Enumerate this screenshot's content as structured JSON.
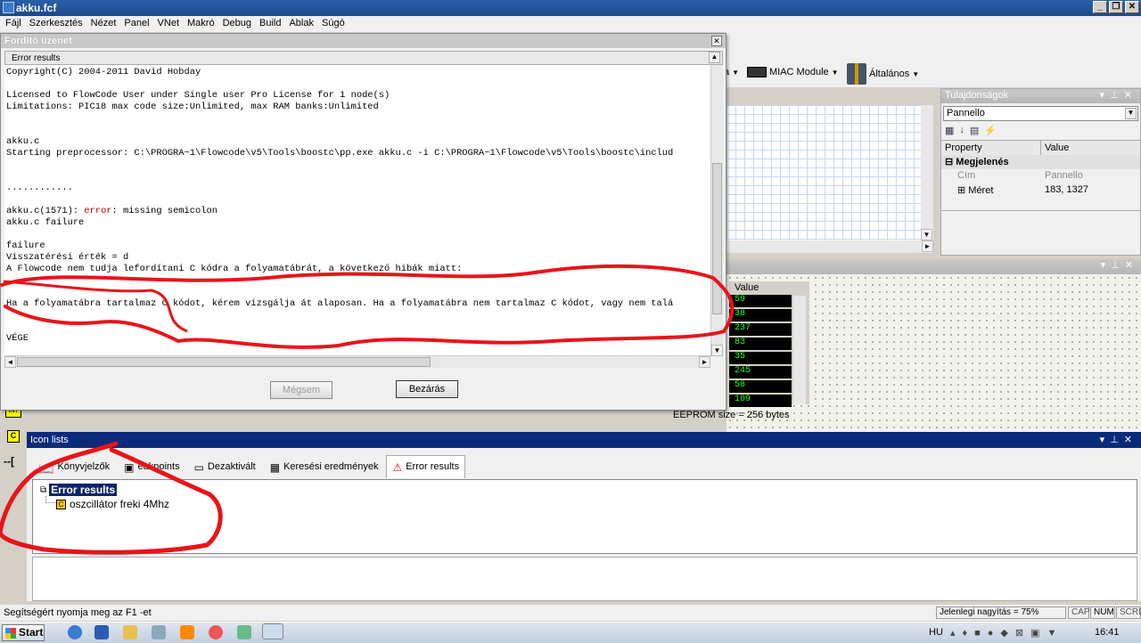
{
  "app": {
    "title": "akku.fcf"
  },
  "menu": [
    "Fájl",
    "Szerkesztés",
    "Nézet",
    "Panel",
    "VNet",
    "Makró",
    "Debug",
    "Build",
    "Ablak",
    "Súgó"
  ],
  "toolbar": {
    "miac_label": "MIAC Module",
    "general_label": "Általános",
    "partial_label": "a"
  },
  "dialog": {
    "title": "Fordító üzenet",
    "section": "Error results",
    "lines": [
      "Copyright(C) 2004-2011 David Hobday",
      "",
      "Licensed to FlowCode User under Single user Pro License for 1 node(s)",
      "Limitations: PIC18 max code size:Unlimited, max RAM banks:Unlimited",
      "",
      "",
      "akku.c",
      "Starting preprocessor: C:\\PROGRA~1\\Flowcode\\v5\\Tools\\boostc\\pp.exe akku.c -i C:\\PROGRA~1\\Flowcode\\v5\\Tools\\boostc\\includ",
      "",
      "",
      "............",
      "",
      "akku.c(1571): ",
      "akku.c failure",
      "",
      "failure",
      "Visszatérési érték = d",
      "A Flowcode nem tudja lefordítani C kódra a folyamatábrát, a következő hibák miatt:",
      "",
      "",
      "Ha a folyamatábra tartalmaz C kódot, kérem vizsgálja át alaposan. Ha a folyamatábra nem tartalmaz C kódot, vagy nem talá",
      "",
      "",
      "VÉGE"
    ],
    "error_keyword": "error",
    "error_msg": ": missing semicolon",
    "cancel": "Mégsem",
    "close": "Bezárás"
  },
  "properties": {
    "title": "Tulajdonságok",
    "selector": "Pannello",
    "col_property": "Property",
    "col_value": "Value",
    "group": "Megjelenés",
    "row1_name": "Cím",
    "row1_value": "Pannello",
    "row2_name": "Méret",
    "row2_value": "183, 1327"
  },
  "memory": {
    "header": "Value",
    "values": [
      "59",
      "38",
      "237",
      "83",
      "35",
      "245",
      "58",
      "109"
    ],
    "eeprom": "EEPROM size = 256 bytes"
  },
  "iconlists": {
    "title": "Icon lists",
    "tabs": [
      "Könyvjelzők",
      "eakpoints",
      "Dezaktivált",
      "Keresési eredmények",
      "Error results"
    ],
    "root": "Error results",
    "child": "oszcillátor freki 4Mhz"
  },
  "status": {
    "help": "Segítségért nyomja meg az F1 -et",
    "zoom": "Jelenlegi nagyítás = 75%",
    "cap": "CAP",
    "num": "NUM",
    "scrl": "SCRL"
  },
  "taskbar": {
    "start": "Start",
    "lang": "HU",
    "time": "16:41"
  },
  "colors": {
    "annotation": "#e8141a",
    "title_bar": "#1c4a8c",
    "icon_lists_bar": "#0a2a7a"
  }
}
